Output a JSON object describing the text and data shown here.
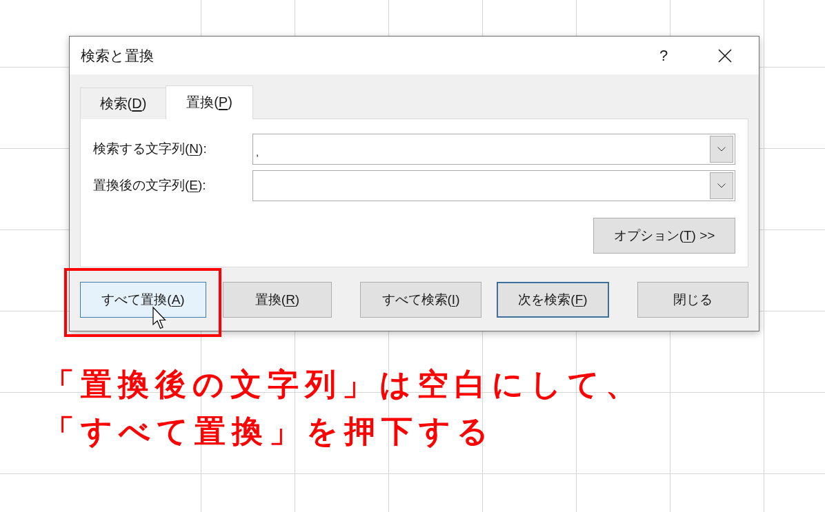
{
  "dialog": {
    "title": "検索と置換",
    "help_button": "?",
    "tabs": [
      {
        "label": "検索(",
        "access_key": "D",
        "label_end": ")",
        "selected": false
      },
      {
        "label": "置換(",
        "access_key": "P",
        "label_end": ")",
        "selected": true
      }
    ],
    "fields": [
      {
        "label": "検索する文字列(",
        "access_key": "N",
        "label_end": "):",
        "value": ","
      },
      {
        "label": "置換後の文字列(",
        "access_key": "E",
        "label_end": "):"
      }
    ],
    "options_button": {
      "label": "オプション(",
      "access_key": "T",
      "label_end": ") >>"
    },
    "buttons": [
      {
        "label": "すべて置換(",
        "access_key": "A",
        "label_end": ")",
        "hovered": true,
        "default": false,
        "highlighted": true
      },
      {
        "label": "置換(",
        "access_key": "R",
        "label_end": ")",
        "hovered": false,
        "default": false,
        "highlighted": false
      },
      {
        "label": "すべて検索(",
        "access_key": "I",
        "label_end": ")",
        "hovered": false,
        "default": false,
        "highlighted": false
      },
      {
        "label": "次を検索(",
        "access_key": "F",
        "label_end": ")",
        "hovered": false,
        "default": true,
        "highlighted": false
      },
      {
        "label": "閉じる",
        "hovered": false,
        "default": false,
        "highlighted": false
      }
    ]
  },
  "annotation": {
    "lines": [
      "「置換後の文字列」は空白にして、",
      "「すべて置換」を押下する"
    ]
  }
}
